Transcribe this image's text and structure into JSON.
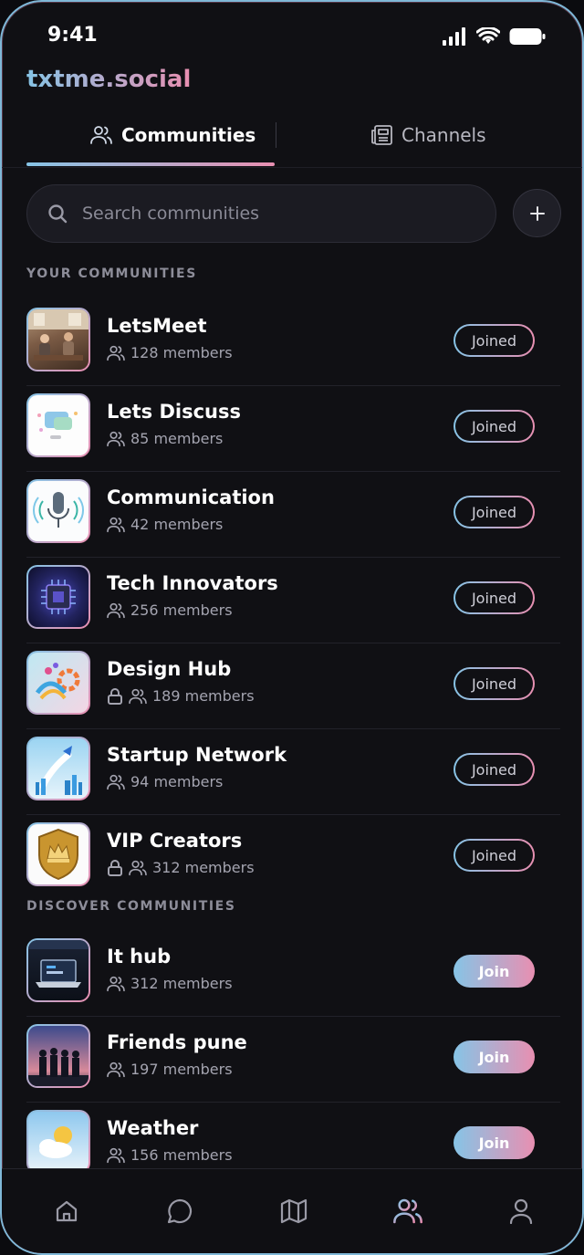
{
  "status_bar": {
    "time": "9:41"
  },
  "brand": "txtme.social",
  "tabs": [
    {
      "label": "Communities",
      "icon": "users-icon",
      "active": true
    },
    {
      "label": "Channels",
      "icon": "newspaper-icon",
      "active": false
    }
  ],
  "search": {
    "placeholder": "Search communities"
  },
  "sections": {
    "yours": "YOUR COMMUNITIES",
    "discover": "DISCOVER COMMUNITIES"
  },
  "your_communities": [
    {
      "name": "LetsMeet",
      "members": "128 members",
      "locked": false,
      "action": "Joined"
    },
    {
      "name": "Lets Discuss",
      "members": "85 members",
      "locked": false,
      "action": "Joined"
    },
    {
      "name": "Communication",
      "members": "42 members",
      "locked": false,
      "action": "Joined"
    },
    {
      "name": "Tech Innovators",
      "members": "256 members",
      "locked": false,
      "action": "Joined"
    },
    {
      "name": "Design Hub",
      "members": "189 members",
      "locked": true,
      "action": "Joined"
    },
    {
      "name": "Startup Network",
      "members": "94 members",
      "locked": false,
      "action": "Joined"
    },
    {
      "name": "VIP Creators",
      "members": "312 members",
      "locked": true,
      "action": "Joined"
    }
  ],
  "discover_communities": [
    {
      "name": "It hub",
      "members": "312 members",
      "action": "Join"
    },
    {
      "name": "Friends pune",
      "members": "197 members",
      "action": "Join"
    },
    {
      "name": "Weather",
      "members": "156 members",
      "action": "Join"
    }
  ],
  "bottom_nav": [
    {
      "icon": "home-icon",
      "active": false
    },
    {
      "icon": "chat-icon",
      "active": false
    },
    {
      "icon": "map-icon",
      "active": false
    },
    {
      "icon": "communities-icon",
      "active": true
    },
    {
      "icon": "profile-icon",
      "active": false
    }
  ],
  "colors": {
    "accent_start": "#86c4e6",
    "accent_end": "#e88fb1",
    "background": "#101014"
  }
}
